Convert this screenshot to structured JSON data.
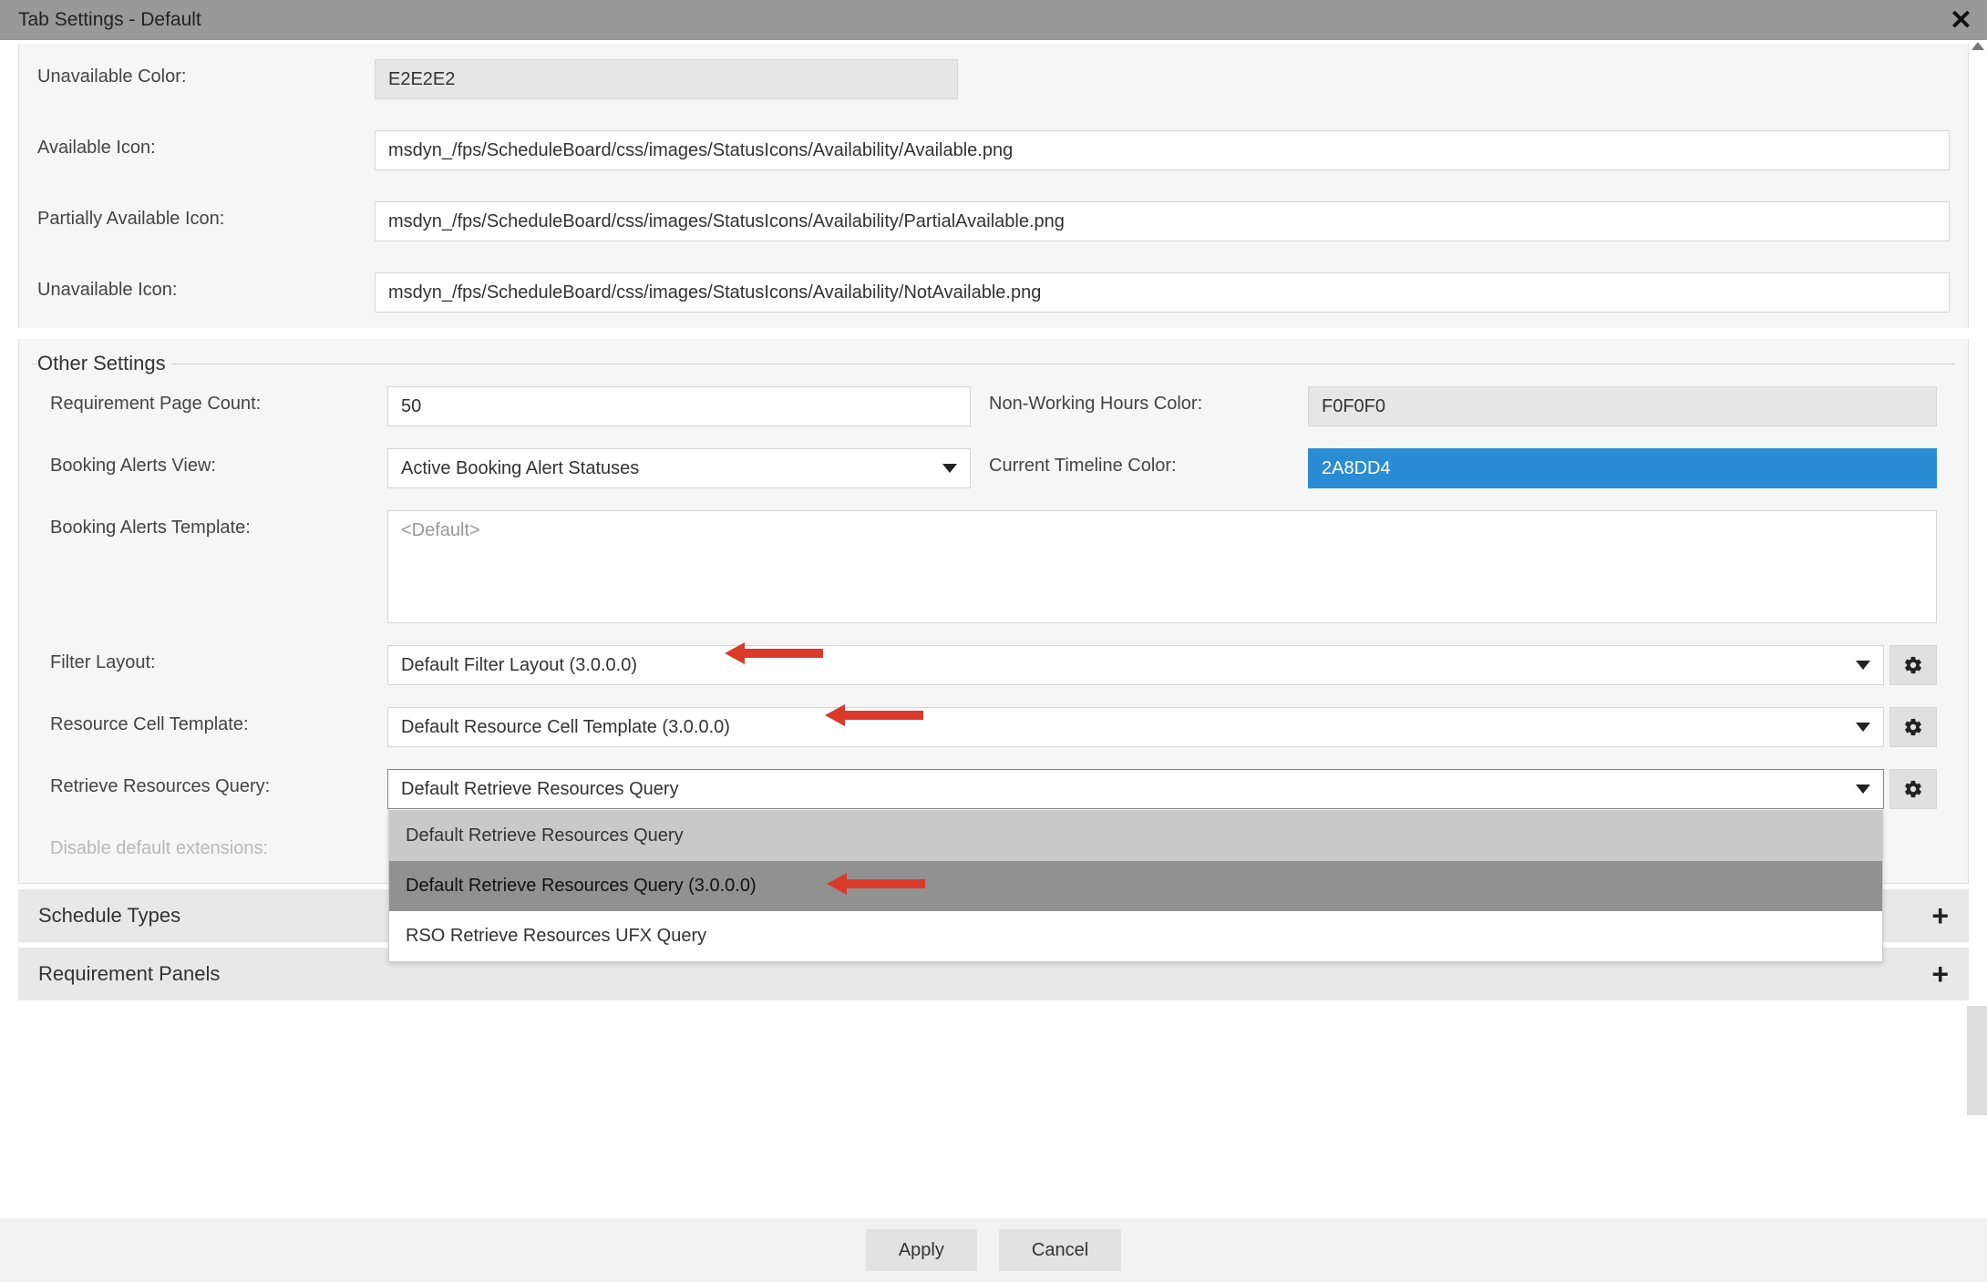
{
  "titlebar": {
    "title": "Tab Settings - Default"
  },
  "iconSection": {
    "unavailableColor": {
      "label": "Unavailable Color:",
      "value": "E2E2E2"
    },
    "availableIcon": {
      "label": "Available Icon:",
      "value": "msdyn_/fps/ScheduleBoard/css/images/StatusIcons/Availability/Available.png"
    },
    "partiallyAvailableIcon": {
      "label": "Partially Available Icon:",
      "value": "msdyn_/fps/ScheduleBoard/css/images/StatusIcons/Availability/PartialAvailable.png"
    },
    "unavailableIcon": {
      "label": "Unavailable Icon:",
      "value": "msdyn_/fps/ScheduleBoard/css/images/StatusIcons/Availability/NotAvailable.png"
    }
  },
  "otherSettings": {
    "legend": "Other Settings",
    "requirementPageCount": {
      "label": "Requirement Page Count:",
      "value": "50"
    },
    "nonWorkingHoursColor": {
      "label": "Non-Working Hours Color:",
      "value": "F0F0F0"
    },
    "bookingAlertsView": {
      "label": "Booking Alerts View:",
      "value": "Active Booking Alert Statuses"
    },
    "currentTimelineColor": {
      "label": "Current Timeline Color:",
      "value": "2A8DD4"
    },
    "bookingAlertsTemplate": {
      "label": "Booking Alerts Template:",
      "placeholder": "<Default>"
    },
    "filterLayout": {
      "label": "Filter Layout:",
      "value": "Default Filter Layout (3.0.0.0)"
    },
    "resourceCellTemplate": {
      "label": "Resource Cell Template:",
      "value": "Default Resource Cell Template (3.0.0.0)"
    },
    "retrieveResourcesQuery": {
      "label": "Retrieve Resources Query:",
      "value": "Default Retrieve Resources Query",
      "options": [
        "Default Retrieve Resources Query",
        "Default Retrieve Resources Query (3.0.0.0)",
        "RSO Retrieve Resources UFX Query"
      ]
    },
    "disableDefaultExtensions": {
      "label": "Disable default extensions:"
    }
  },
  "accordions": {
    "scheduleTypes": "Schedule Types",
    "requirementPanels": "Requirement Panels"
  },
  "footer": {
    "apply": "Apply",
    "cancel": "Cancel"
  }
}
